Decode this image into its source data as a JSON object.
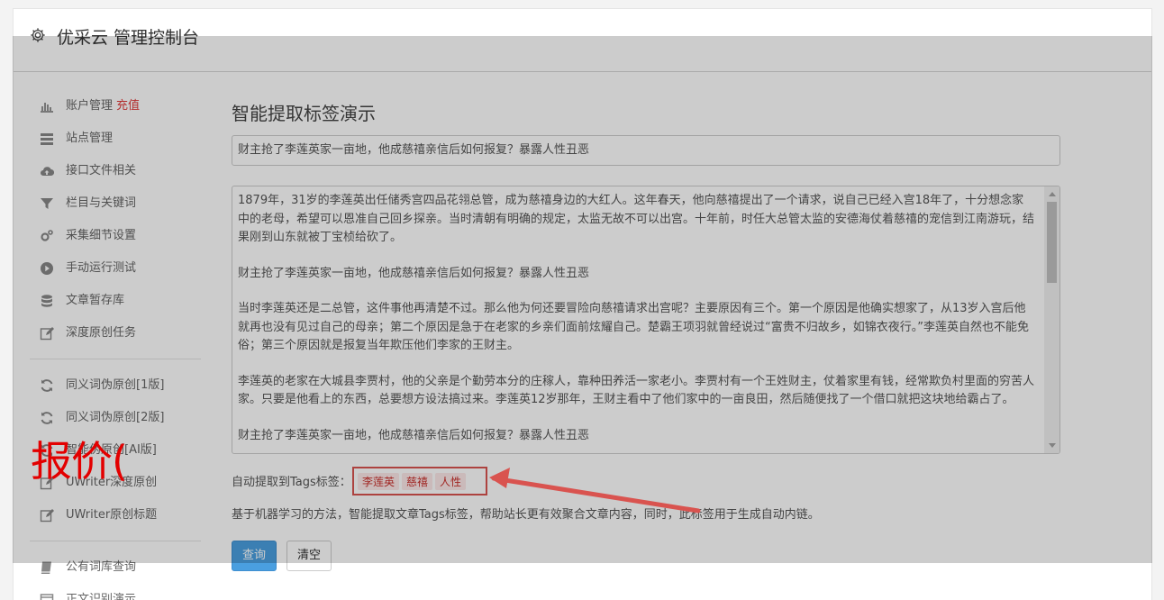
{
  "header": {
    "title": "优采云 管理控制台",
    "icon": "gear-icon"
  },
  "sidebar": {
    "items": [
      {
        "label": "账户管理",
        "badge": "充值",
        "icon": "bar-chart-icon"
      },
      {
        "label": "站点管理",
        "icon": "server-icon"
      },
      {
        "label": "接口文件相关",
        "icon": "cloud-upload-icon"
      },
      {
        "label": "栏目与关键词",
        "icon": "filter-icon"
      },
      {
        "label": "采集细节设置",
        "icon": "cogs-icon"
      },
      {
        "label": "手动运行测试",
        "icon": "play-circle-icon"
      },
      {
        "label": "文章暂存库",
        "icon": "database-icon"
      },
      {
        "label": "深度原创任务",
        "icon": "edit-icon"
      }
    ],
    "items2": [
      {
        "label": "同义词伪原创[1版]",
        "icon": "refresh-icon"
      },
      {
        "label": "同义词伪原创[2版]",
        "icon": "refresh-icon"
      },
      {
        "label": "智能伪原创[AI版]",
        "icon": "refresh-icon"
      },
      {
        "label": "UWriter深度原创",
        "icon": "edit-icon"
      },
      {
        "label": "UWriter原创标题",
        "icon": "edit-icon"
      }
    ],
    "items3": [
      {
        "label": "公有词库查询",
        "icon": "book-icon"
      },
      {
        "label": "正文识别演示",
        "icon": "window-icon"
      }
    ]
  },
  "main": {
    "page_title": "智能提取标签演示",
    "title_value": "财主抢了李莲英家一亩地，他成慈禧亲信后如何报复？暴露人性丑恶",
    "content_paragraphs": [
      "1879年，31岁的李莲英出任储秀宫四品花翎总管，成为慈禧身边的大红人。这年春天，他向慈禧提出了一个请求，说自己已经入宫18年了，十分想念家中的老母，希望可以恩准自己回乡探亲。当时清朝有明确的规定，太监无故不可以出宫。十年前，时任大总管太监的安德海仗着慈禧的宠信到江南游玩，结果刚到山东就被丁宝桢给砍了。",
      "财主抢了李莲英家一亩地，他成慈禧亲信后如何报复？暴露人性丑恶",
      "当时李莲英还是二总管，这件事他再清楚不过。那么他为何还要冒险向慈禧请求出宫呢？主要原因有三个。第一个原因是他确实想家了，从13岁入宫后他就再也没有见过自己的母亲；第二个原因是急于在老家的乡亲们面前炫耀自己。楚霸王项羽就曾经说过“富贵不归故乡，如锦衣夜行。”李莲英自然也不能免俗；第三个原因就是报复当年欺压他们李家的王财主。",
      "李莲英的老家在大城县李贾村，他的父亲是个勤劳本分的庄稼人，靠种田养活一家老小。李贾村有一个王姓财主，仗着家里有钱，经常欺负村里面的穷苦人家。只要是他看上的东西，总要想方设法搞过来。李莲英12岁那年，王财主看中了他们家中的一亩良田，然后随便找了一个借口就把这块地给霸占了。",
      "财主抢了李莲英家一亩地，他成慈禧亲信后如何报复？暴露人性丑恶"
    ],
    "tags_label": "自动提取到Tags标签：",
    "tags": [
      "李莲英",
      "慈禧",
      "人性"
    ],
    "description": "基于机器学习的方法，智能提取文章Tags标签，帮助站长更有效聚合文章内容，同时，此标签用于生成自动内链。",
    "query_button": "查询",
    "clear_button": "清空"
  },
  "annotation": {
    "text": "报价(",
    "color": "#e30000"
  },
  "colors": {
    "primary": "#4a9fe0",
    "highlight_red": "#d9534f",
    "badge_red": "#e03a3a"
  }
}
